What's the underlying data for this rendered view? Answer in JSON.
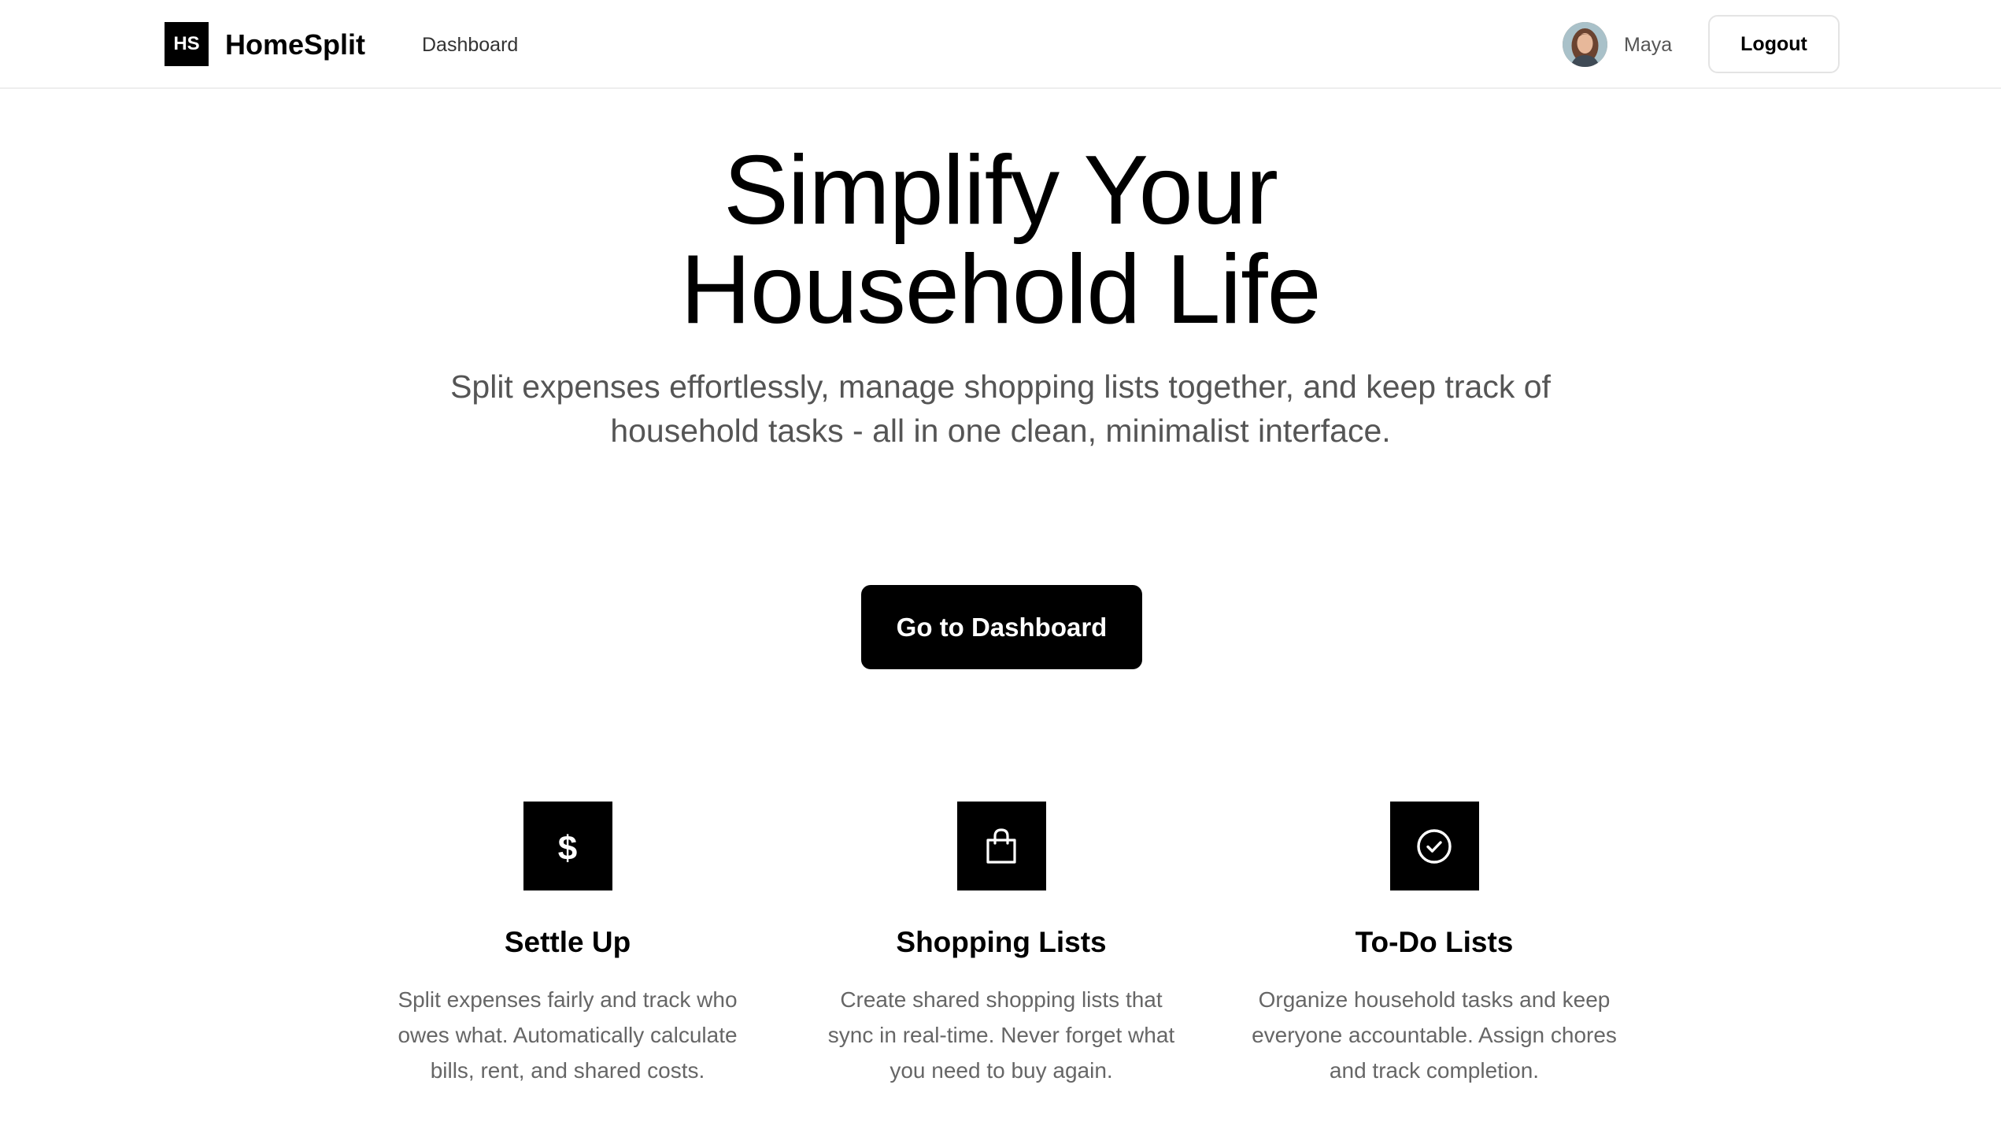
{
  "header": {
    "logo_text": "HS",
    "brand": "HomeSplit",
    "nav_dashboard": "Dashboard",
    "user_name": "Maya",
    "logout_label": "Logout"
  },
  "hero": {
    "title_line1": "Simplify Your",
    "title_line2": "Household Life",
    "subtitle": "Split expenses effortlessly, manage shopping lists together, and keep track of household tasks - all in one clean, minimalist interface.",
    "cta_label": "Go to Dashboard"
  },
  "features": [
    {
      "icon": "dollar-icon",
      "title": "Settle Up",
      "description": "Split expenses fairly and track who owes what. Automatically calculate bills, rent, and shared costs."
    },
    {
      "icon": "shopping-bag-icon",
      "title": "Shopping Lists",
      "description": "Create shared shopping lists that sync in real-time. Never forget what you need to buy again."
    },
    {
      "icon": "check-circle-icon",
      "title": "To-Do Lists",
      "description": "Organize household tasks and keep everyone accountable. Assign chores and track completion."
    }
  ],
  "colors": {
    "primary": "#000000",
    "background": "#ffffff",
    "muted_text": "#666666",
    "border": "#e4e4e4"
  }
}
